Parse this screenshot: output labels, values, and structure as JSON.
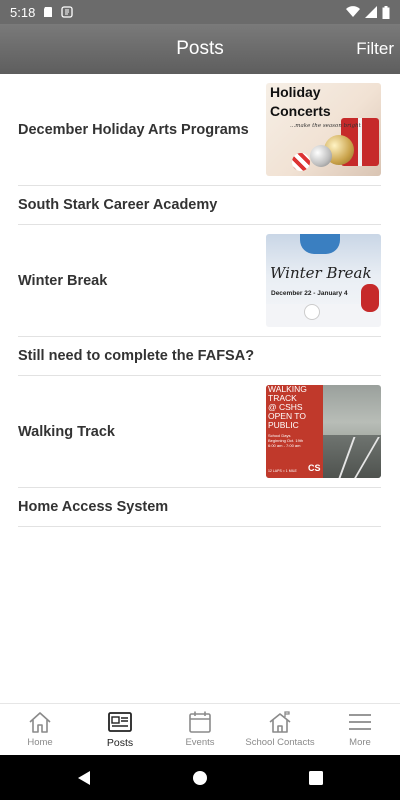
{
  "status_bar": {
    "time": "5:18"
  },
  "app_bar": {
    "title": "Posts",
    "filter_label": "Filter"
  },
  "posts": [
    {
      "title": "December Holiday Arts Programs",
      "thumb": {
        "line1": "Holiday",
        "line2": "Concerts",
        "tagline": "...make the season bright"
      }
    },
    {
      "title": "South Stark Career Academy"
    },
    {
      "title": "Winter Break",
      "thumb": {
        "line1": "Winter Break",
        "line2": "December 22 - January 4"
      }
    },
    {
      "title": "Still need to complete the FAFSA?"
    },
    {
      "title": "Walking Track",
      "thumb": {
        "line1": "WALKING",
        "line2": "TRACK",
        "line3": "@ CSHS",
        "line4": "OPEN TO",
        "line5": "PUBLIC",
        "line6": "School Days",
        "line7": "Beginning Oct. 19th",
        "line8": "6:00 am - 7:00 am",
        "line9": "12 LAPS = 1 MILE",
        "logo": "CS"
      }
    },
    {
      "title": "Home Access System"
    }
  ],
  "bottom_nav": [
    {
      "label": "Home",
      "icon": "home-icon",
      "active": false
    },
    {
      "label": "Posts",
      "icon": "posts-icon",
      "active": true
    },
    {
      "label": "Events",
      "icon": "calendar-icon",
      "active": false
    },
    {
      "label": "School Contacts",
      "icon": "school-icon",
      "active": false
    },
    {
      "label": "More",
      "icon": "menu-icon",
      "active": false
    }
  ],
  "colors": {
    "app_bar": "#6e6e6e",
    "status_bar": "#6b6b6b",
    "title_text": "#333333",
    "track_red": "#c0392b"
  }
}
